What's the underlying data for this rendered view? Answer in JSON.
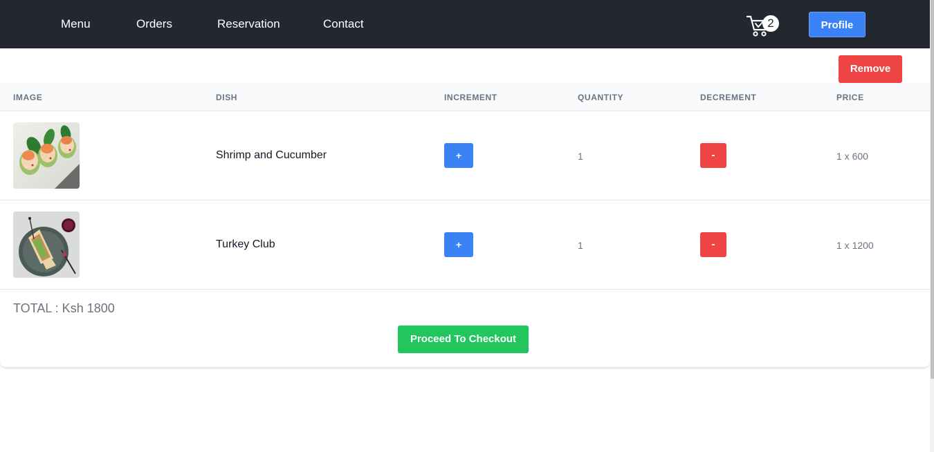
{
  "nav": {
    "links": [
      "Menu",
      "Orders",
      "Reservation",
      "Contact"
    ],
    "cart_icon": "shopping-cart-icon",
    "cart_count": "2",
    "profile_label": "Profile"
  },
  "cart": {
    "remove_label": "Remove",
    "columns": [
      "IMAGE",
      "DISH",
      "INCREMENT",
      "QUANTITY",
      "DECREMENT",
      "PRICE"
    ],
    "items": [
      {
        "image": "shrimp-cucumber-photo",
        "dish": "Shrimp and Cucumber",
        "increment_label": "+",
        "quantity": "1",
        "decrement_label": "-",
        "price": "1 x 600"
      },
      {
        "image": "turkey-club-photo",
        "dish": "Turkey Club",
        "increment_label": "+",
        "quantity": "1",
        "decrement_label": "-",
        "price": "1 x 1200"
      }
    ],
    "total": "TOTAL : Ksh 1800",
    "checkout_label": "Proceed To Checkout"
  },
  "colors": {
    "navbar": "#232730",
    "primary_blue": "#3b82f6",
    "danger_red": "#ef4444",
    "success_green": "#22c55e"
  }
}
